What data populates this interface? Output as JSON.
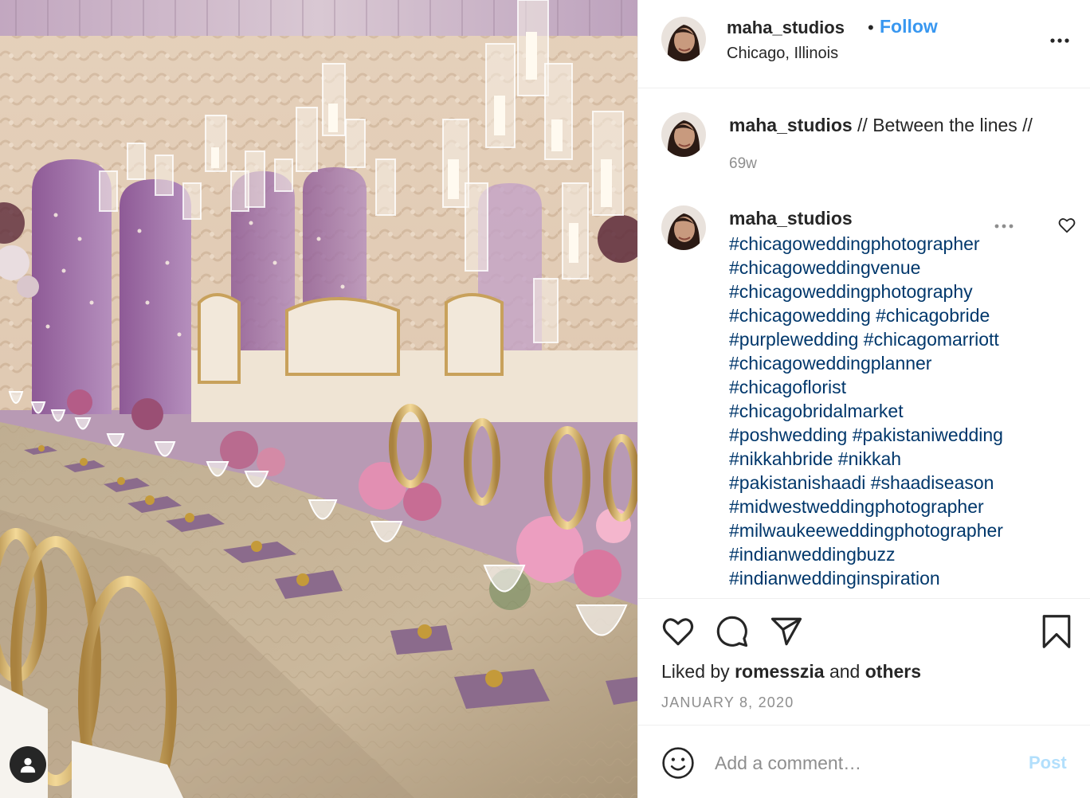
{
  "post": {
    "username": "maha_studios",
    "follow_label": "Follow",
    "separator": "•",
    "location": "Chicago, Illinois",
    "caption_text": " // Between the lines //",
    "caption_age": "69w",
    "hashtags": [
      "#chicagoweddingphotographer",
      "#chicagoweddingvenue",
      "#chicagoweddingphotography",
      "#chicagowedding #chicagobride",
      "#purplewedding #chicagomarriott",
      "#chicagoweddingplanner",
      "#chicagoflorist",
      "#chicagobridalmarket",
      "#poshwedding #pakistaniwedding",
      "#nikkahbride #nikkah",
      "#pakistanishaadi #shaadiseason",
      "#midwestweddingphotographer",
      "#milwaukeeweddingphotographer",
      "#indianweddingbuzz",
      "#indianweddinginspiration"
    ],
    "liked_by_prefix": "Liked by ",
    "liked_by_user": "romesszia",
    "liked_by_and": " and ",
    "liked_by_others": "others",
    "date": "JANUARY 8, 2020"
  },
  "composer": {
    "placeholder": "Add a comment…",
    "post_label": "Post"
  },
  "icons": {
    "more": "more-options-icon",
    "like": "heart-icon",
    "comment": "comment-icon",
    "share": "paper-plane-icon",
    "save": "bookmark-icon",
    "emoji": "emoji-icon",
    "user_tag": "user-tag-icon"
  },
  "colors": {
    "link_blue": "#3897f0",
    "hashtag": "#00376b",
    "muted": "#8e8e8e",
    "post_disabled": "#b2dffc"
  }
}
